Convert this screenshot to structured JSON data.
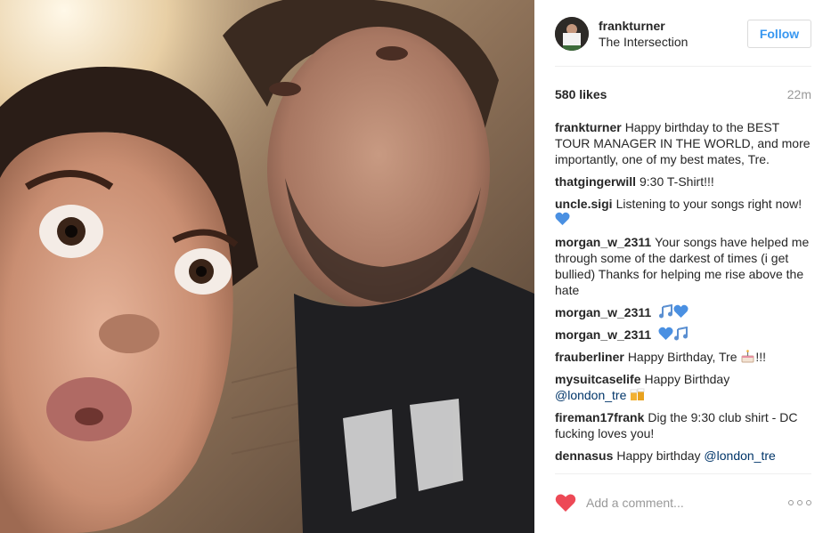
{
  "post": {
    "username": "frankturner",
    "location": "The Intersection",
    "follow_label": "Follow",
    "likes": "580 likes",
    "time": "22m"
  },
  "comments": [
    {
      "author": "frankturner",
      "text": "Happy birthday to the BEST TOUR MANAGER IN THE WORLD, and more importantly, one of my best mates, Tre."
    },
    {
      "author": "thatgingerwill",
      "text": "9:30 T-Shirt!!!"
    },
    {
      "author": "uncle.sigi",
      "text": "Listening to your songs right now!",
      "emoji": [
        "blue-heart"
      ]
    },
    {
      "author": "morgan_w_2311",
      "text": "Your songs have helped me through some of the darkest of times (i get bullied) Thanks for helping me rise above the hate"
    },
    {
      "author": "morgan_w_2311",
      "text": "",
      "emoji": [
        "music-notes",
        "blue-heart"
      ]
    },
    {
      "author": "morgan_w_2311",
      "text": "",
      "emoji": [
        "blue-heart",
        "music-notes"
      ]
    },
    {
      "author": "frauberliner",
      "text": "Happy Birthday, Tre",
      "emoji": [
        "cake"
      ],
      "after": "!!!"
    },
    {
      "author": "mysuitcaselife",
      "text": "Happy Birthday",
      "mention": "@london_tre",
      "emoji": [
        "beers"
      ]
    },
    {
      "author": "fireman17frank",
      "text": "Dig the 9:30 club shirt - DC fucking loves you!"
    },
    {
      "author": "dennasus",
      "text": "Happy birthday",
      "mention": "@london_tre"
    }
  ],
  "input": {
    "placeholder": "Add a comment..."
  },
  "icons": {
    "like": "heart-icon",
    "more": "more-options-icon"
  },
  "colors": {
    "accent": "#3897f0",
    "heart": "#ed4956",
    "mention": "#003569"
  }
}
